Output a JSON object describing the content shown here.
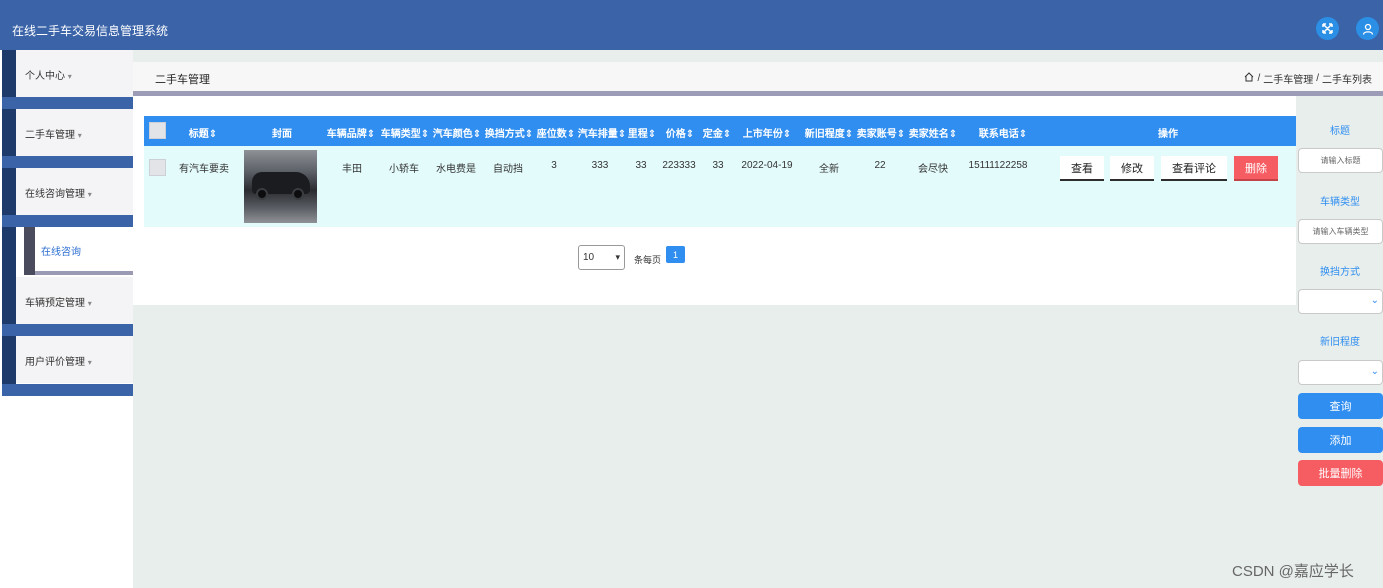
{
  "app": {
    "title": "在线二手车交易信息管理系统"
  },
  "topbar": {
    "fullscreen_icon": "expand-icon",
    "user_icon": "user-icon"
  },
  "sidebar": {
    "menus": [
      {
        "label": "个人中心",
        "arrow": "▾"
      },
      {
        "label": "二手车管理",
        "arrow": "▾"
      },
      {
        "label": "在线咨询管理",
        "arrow": "▾"
      },
      {
        "label": "车辆预定管理",
        "arrow": "▾"
      },
      {
        "label": "用户评价管理",
        "arrow": "▾"
      }
    ],
    "submenu": {
      "label": "在线咨询"
    }
  },
  "header": {
    "page_title": "二手车管理",
    "breadcrumb": [
      "二手车管理",
      "二手车列表"
    ],
    "separator": "/"
  },
  "table": {
    "columns": [
      "标题",
      "封面",
      "车辆品牌",
      "车辆类型",
      "汽车颜色",
      "换挡方式",
      "座位数",
      "汽车排量",
      "里程",
      "价格",
      "定金",
      "上市年份",
      "新旧程度",
      "卖家账号",
      "卖家姓名",
      "联系电话",
      "操作"
    ],
    "rows": [
      {
        "title": "有汽车要卖",
        "brand": "丰田",
        "type": "小轿车",
        "color": "水电费是",
        "gear": "自动挡",
        "seats": "3",
        "displacement": "333",
        "mileage": "33",
        "price": "223333",
        "deposit": "33",
        "year": "2022-04-19",
        "condition": "全新",
        "seller_account": "22",
        "seller_name": "会尽快",
        "phone": "15111122258"
      }
    ],
    "actions": {
      "view": "查看",
      "edit": "修改",
      "view_reviews": "查看评论",
      "delete": "删除"
    }
  },
  "pagination": {
    "page_size": "10",
    "page_size_label": "条每页",
    "current_page": "1"
  },
  "search": {
    "title_label": "标题",
    "title_placeholder": "请输入标题",
    "type_label": "车辆类型",
    "type_placeholder": "请输入车辆类型",
    "gear_label": "换挡方式",
    "condition_label": "新旧程度",
    "query_button": "查询",
    "add_button": "添加",
    "batch_delete_button": "批量删除"
  },
  "colors": {
    "topbar": "#3a63a8",
    "table_header": "#2f8ef0",
    "row_bg": "#e4fbfc",
    "danger": "#f65d63"
  },
  "watermark": "CSDN @嘉应学长"
}
